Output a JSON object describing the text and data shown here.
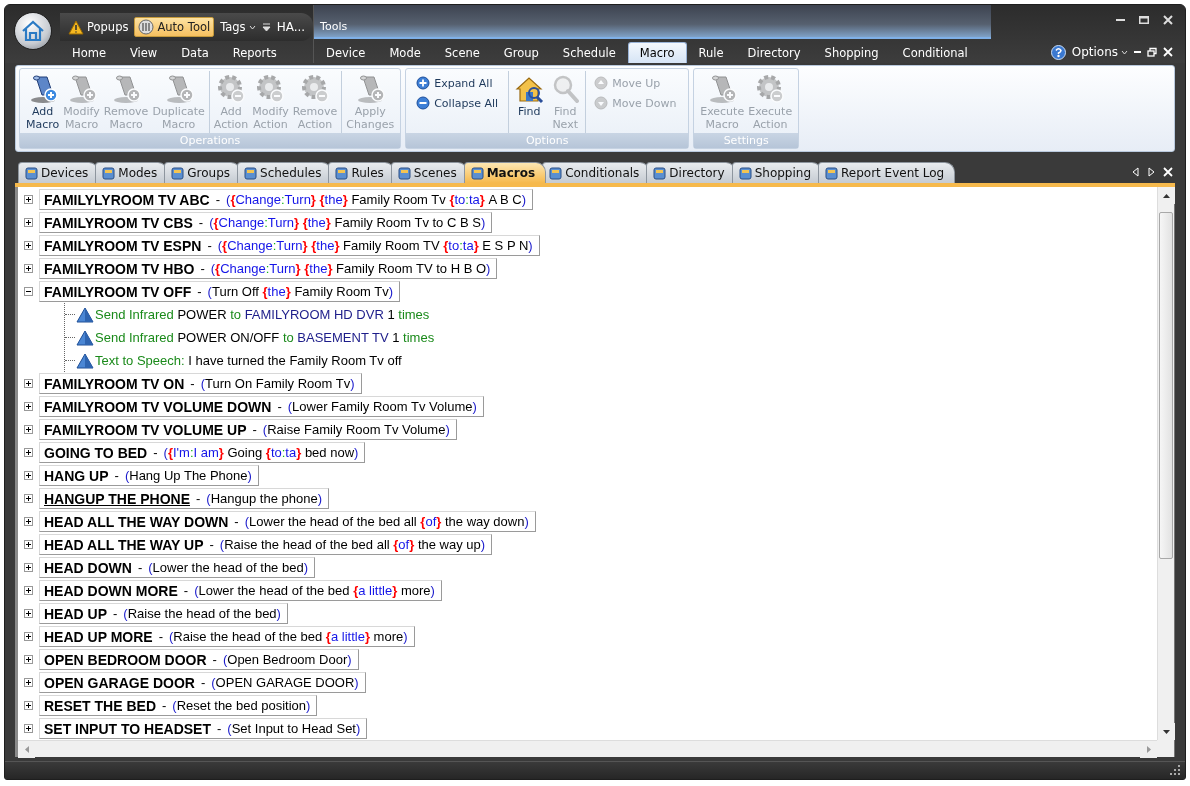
{
  "quick_access": {
    "items": [
      {
        "kind": "warning",
        "label": "Popups",
        "selected": false
      },
      {
        "kind": "dial",
        "label": "Auto Tool",
        "selected": true
      },
      {
        "kind": "menu",
        "label": "Tags",
        "selected": false
      }
    ],
    "title": "HA..."
  },
  "ribbon_tabs": [
    {
      "label": "Home",
      "selected": false
    },
    {
      "label": "View",
      "selected": false
    },
    {
      "label": "Data",
      "selected": false
    },
    {
      "label": "Reports",
      "selected": false
    }
  ],
  "tools": {
    "label": "Tools",
    "tabs": [
      {
        "label": "Device",
        "selected": false
      },
      {
        "label": "Mode",
        "selected": false
      },
      {
        "label": "Scene",
        "selected": false
      },
      {
        "label": "Group",
        "selected": false
      },
      {
        "label": "Schedule",
        "selected": false
      },
      {
        "label": "Macro",
        "selected": true
      },
      {
        "label": "Rule",
        "selected": false
      },
      {
        "label": "Directory",
        "selected": false
      },
      {
        "label": "Shopping",
        "selected": false
      },
      {
        "label": "Conditional",
        "selected": false
      }
    ]
  },
  "options_menu": {
    "label": "Options"
  },
  "ribbon_groups": [
    {
      "label": "Operations",
      "sets": [
        {
          "kind": "large",
          "buttons": [
            {
              "kind": "macro",
              "label": "Add Macro",
              "disabled": false
            },
            {
              "kind": "macro",
              "label": "Modify Macro",
              "disabled": true
            },
            {
              "kind": "macro",
              "label": "Remove Macro",
              "disabled": true
            },
            {
              "kind": "macro",
              "label": "Duplicate Macro",
              "disabled": true
            }
          ]
        },
        {
          "kind": "large",
          "buttons": [
            {
              "kind": "action",
              "label": "Add Action",
              "disabled": true
            },
            {
              "kind": "action",
              "label": "Modify Action",
              "disabled": true
            },
            {
              "kind": "action",
              "label": "Remove Action",
              "disabled": true
            }
          ]
        },
        {
          "kind": "large",
          "buttons": [
            {
              "kind": "macro",
              "label": "Apply Changes",
              "disabled": true
            }
          ]
        }
      ]
    },
    {
      "label": "Options",
      "sets": [
        {
          "kind": "small",
          "buttons": [
            {
              "kind": "expand",
              "label": "Expand All",
              "disabled": false
            },
            {
              "kind": "collapse",
              "label": "Collapse All",
              "disabled": false
            }
          ]
        },
        {
          "kind": "large",
          "buttons": [
            {
              "kind": "find",
              "label": "Find",
              "disabled": false
            },
            {
              "kind": "find-next",
              "label": "Find Next",
              "disabled": true
            }
          ]
        },
        {
          "kind": "small",
          "buttons": [
            {
              "kind": "up",
              "label": "Move Up",
              "disabled": true
            },
            {
              "kind": "down",
              "label": "Move Down",
              "disabled": true
            }
          ]
        }
      ]
    },
    {
      "label": "Settings",
      "sets": [
        {
          "kind": "large",
          "buttons": [
            {
              "kind": "macro",
              "label": "Execute Macro",
              "disabled": true
            },
            {
              "kind": "action",
              "label": "Execute Action",
              "disabled": true
            }
          ]
        }
      ]
    }
  ],
  "document_tabs": [
    {
      "label": "Devices",
      "selected": false
    },
    {
      "label": "Modes",
      "selected": false
    },
    {
      "label": "Groups",
      "selected": false
    },
    {
      "label": "Schedules",
      "selected": false
    },
    {
      "label": "Rules",
      "selected": false
    },
    {
      "label": "Scenes",
      "selected": false
    },
    {
      "label": "Macros",
      "selected": true
    },
    {
      "label": "Conditionals",
      "selected": false
    },
    {
      "label": "Directory",
      "selected": false
    },
    {
      "label": "Shopping",
      "selected": false
    },
    {
      "label": "Report Event Log",
      "selected": false
    }
  ],
  "macros": [
    {
      "name": "FAMILYLYROOM TV ABC",
      "separator": "-",
      "expanded": false,
      "focused": false,
      "phrase": {
        "open": "(",
        "close": ")",
        "parts": [
          {
            "kind": "option",
            "open": "{",
            "close": "}",
            "sep": ":",
            "choices": [
              "Change",
              "Turn"
            ]
          },
          {
            "kind": "option",
            "open": "{",
            "close": "}",
            "choices": [
              "the"
            ]
          },
          {
            "kind": "text",
            "text": "Family Room Tv"
          },
          {
            "kind": "option",
            "open": "{",
            "close": "}",
            "sep": ":",
            "choices": [
              "to",
              "ta"
            ]
          },
          {
            "kind": "text",
            "text": "A B C"
          }
        ]
      }
    },
    {
      "name": "FAMILYROOM TV CBS",
      "separator": "-",
      "expanded": false,
      "focused": false,
      "phrase": {
        "open": "(",
        "close": ")",
        "parts": [
          {
            "kind": "option",
            "open": "{",
            "close": "}",
            "sep": ":",
            "choices": [
              "Change",
              "Turn"
            ]
          },
          {
            "kind": "option",
            "open": "{",
            "close": "}",
            "choices": [
              "the"
            ]
          },
          {
            "kind": "text",
            "text": "Family Room Tv to C B S"
          }
        ]
      }
    },
    {
      "name": "FAMILYROOM TV ESPN",
      "separator": "-",
      "expanded": false,
      "focused": false,
      "phrase": {
        "open": "(",
        "close": ")",
        "parts": [
          {
            "kind": "option",
            "open": "{",
            "close": "}",
            "sep": ":",
            "choices": [
              "Change",
              "Turn"
            ]
          },
          {
            "kind": "option",
            "open": "{",
            "close": "}",
            "choices": [
              "the"
            ]
          },
          {
            "kind": "text",
            "text": "Family Room TV"
          },
          {
            "kind": "option",
            "open": "{",
            "close": "}",
            "sep": ":",
            "choices": [
              "to",
              "ta"
            ]
          },
          {
            "kind": "text",
            "text": "E S P N"
          }
        ]
      }
    },
    {
      "name": "FAMILYROOM TV HBO",
      "separator": "-",
      "expanded": false,
      "focused": false,
      "phrase": {
        "open": "(",
        "close": ")",
        "parts": [
          {
            "kind": "option",
            "open": "{",
            "close": "}",
            "sep": ":",
            "choices": [
              "Change",
              "Turn"
            ]
          },
          {
            "kind": "option",
            "open": "{",
            "close": "}",
            "choices": [
              "the"
            ]
          },
          {
            "kind": "text",
            "text": "Family Room TV to H B O"
          }
        ]
      }
    },
    {
      "name": "FAMILYROOM TV OFF",
      "separator": "-",
      "expanded": true,
      "focused": false,
      "phrase": {
        "open": "(",
        "close": ")",
        "parts": [
          {
            "kind": "text",
            "text": "Turn Off"
          },
          {
            "kind": "option",
            "open": "{",
            "close": "}",
            "choices": [
              "the"
            ]
          },
          {
            "kind": "text",
            "text": "Family Room Tv"
          }
        ]
      },
      "actions": [
        {
          "parts": [
            {
              "kind": "verb",
              "text": "Send Infrared"
            },
            {
              "kind": "value",
              "text": "POWER"
            },
            {
              "kind": "verb",
              "text": "to"
            },
            {
              "kind": "target",
              "text": "FAMILYROOM HD DVR"
            },
            {
              "kind": "value",
              "text": "1"
            },
            {
              "kind": "verb",
              "text": "times"
            }
          ]
        },
        {
          "parts": [
            {
              "kind": "verb",
              "text": "Send Infrared"
            },
            {
              "kind": "value",
              "text": "POWER ON/OFF"
            },
            {
              "kind": "verb",
              "text": "to"
            },
            {
              "kind": "target",
              "text": "BASEMENT TV"
            },
            {
              "kind": "value",
              "text": "1"
            },
            {
              "kind": "verb",
              "text": "times"
            }
          ]
        },
        {
          "parts": [
            {
              "kind": "verb",
              "text": "Text to Speech:"
            },
            {
              "kind": "value",
              "text": "I have turned the Family Room Tv off"
            }
          ]
        }
      ]
    },
    {
      "name": "FAMILYROOM TV ON",
      "separator": "-",
      "expanded": false,
      "focused": false,
      "phrase": {
        "open": "(",
        "close": ")",
        "parts": [
          {
            "kind": "text",
            "text": "Turn On Family Room Tv"
          }
        ]
      }
    },
    {
      "name": "FAMILYROOM TV VOLUME DOWN",
      "separator": "-",
      "expanded": false,
      "focused": false,
      "phrase": {
        "open": "(",
        "close": ")",
        "parts": [
          {
            "kind": "text",
            "text": "Lower Family Room Tv Volume"
          }
        ]
      }
    },
    {
      "name": "FAMILYROOM TV VOLUME UP",
      "separator": "-",
      "expanded": false,
      "focused": false,
      "phrase": {
        "open": "(",
        "close": ")",
        "parts": [
          {
            "kind": "text",
            "text": "Raise Family Room Tv Volume"
          }
        ]
      }
    },
    {
      "name": "GOING TO BED",
      "separator": "-",
      "expanded": false,
      "focused": false,
      "phrase": {
        "open": "(",
        "close": ")",
        "parts": [
          {
            "kind": "option",
            "open": "{",
            "close": "}",
            "sep": ":",
            "choices": [
              "I'm",
              "I am"
            ]
          },
          {
            "kind": "text",
            "text": "Going"
          },
          {
            "kind": "option",
            "open": "{",
            "close": "}",
            "sep": ":",
            "choices": [
              "to",
              "ta"
            ]
          },
          {
            "kind": "text",
            "text": "bed now"
          }
        ]
      }
    },
    {
      "name": "HANG UP",
      "separator": "-",
      "expanded": false,
      "focused": false,
      "phrase": {
        "open": "(",
        "close": ")",
        "parts": [
          {
            "kind": "text",
            "text": "Hang Up The Phone"
          }
        ]
      }
    },
    {
      "name": "HANGUP THE PHONE",
      "separator": "-",
      "expanded": false,
      "focused": true,
      "phrase": {
        "open": "(",
        "close": ")",
        "parts": [
          {
            "kind": "text",
            "text": "Hangup the phone"
          }
        ]
      }
    },
    {
      "name": "HEAD ALL THE WAY DOWN",
      "separator": "-",
      "expanded": false,
      "focused": false,
      "phrase": {
        "open": "(",
        "close": ")",
        "parts": [
          {
            "kind": "text",
            "text": "Lower the head of the bed all"
          },
          {
            "kind": "option",
            "open": "{",
            "close": "}",
            "choices": [
              "of"
            ]
          },
          {
            "kind": "text",
            "text": "the way down"
          }
        ]
      }
    },
    {
      "name": "HEAD ALL THE WAY UP",
      "separator": "-",
      "expanded": false,
      "focused": false,
      "phrase": {
        "open": "(",
        "close": ")",
        "parts": [
          {
            "kind": "text",
            "text": "Raise the head of the bed all"
          },
          {
            "kind": "option",
            "open": "{",
            "close": "}",
            "choices": [
              "of"
            ]
          },
          {
            "kind": "text",
            "text": "the way up"
          }
        ]
      }
    },
    {
      "name": "HEAD DOWN",
      "separator": "-",
      "expanded": false,
      "focused": false,
      "phrase": {
        "open": "(",
        "close": ")",
        "parts": [
          {
            "kind": "text",
            "text": "Lower the head of the bed"
          }
        ]
      }
    },
    {
      "name": "HEAD DOWN MORE",
      "separator": "-",
      "expanded": false,
      "focused": false,
      "phrase": {
        "open": "(",
        "close": ")",
        "parts": [
          {
            "kind": "text",
            "text": "Lower the head of the bed"
          },
          {
            "kind": "option",
            "open": "{",
            "close": "}",
            "choices": [
              "a little"
            ]
          },
          {
            "kind": "text",
            "text": "more"
          }
        ]
      }
    },
    {
      "name": "HEAD UP",
      "separator": "-",
      "expanded": false,
      "focused": false,
      "phrase": {
        "open": "(",
        "close": ")",
        "parts": [
          {
            "kind": "text",
            "text": "Raise the head of the bed"
          }
        ]
      }
    },
    {
      "name": "HEAD UP MORE",
      "separator": "-",
      "expanded": false,
      "focused": false,
      "phrase": {
        "open": "(",
        "close": ")",
        "parts": [
          {
            "kind": "text",
            "text": "Raise the head of the bed"
          },
          {
            "kind": "option",
            "open": "{",
            "close": "}",
            "choices": [
              "a little"
            ]
          },
          {
            "kind": "text",
            "text": "more"
          }
        ]
      }
    },
    {
      "name": "OPEN BEDROOM DOOR",
      "separator": "-",
      "expanded": false,
      "focused": false,
      "phrase": {
        "open": "(",
        "close": ")",
        "parts": [
          {
            "kind": "text",
            "text": "Open Bedroom Door"
          }
        ]
      }
    },
    {
      "name": "OPEN GARAGE DOOR",
      "separator": "-",
      "expanded": false,
      "focused": false,
      "phrase": {
        "open": "(",
        "close": ")",
        "parts": [
          {
            "kind": "text",
            "text": "OPEN GARAGE DOOR"
          }
        ]
      }
    },
    {
      "name": "RESET THE BED",
      "separator": "-",
      "expanded": false,
      "focused": false,
      "phrase": {
        "open": "(",
        "close": ")",
        "parts": [
          {
            "kind": "text",
            "text": "Reset the bed position"
          }
        ]
      }
    },
    {
      "name": "SET INPUT TO HEADSET",
      "separator": "-",
      "expanded": false,
      "focused": false,
      "phrase": {
        "open": "(",
        "close": ")",
        "parts": [
          {
            "kind": "text",
            "text": "Set Input to Head Set"
          }
        ]
      }
    }
  ]
}
